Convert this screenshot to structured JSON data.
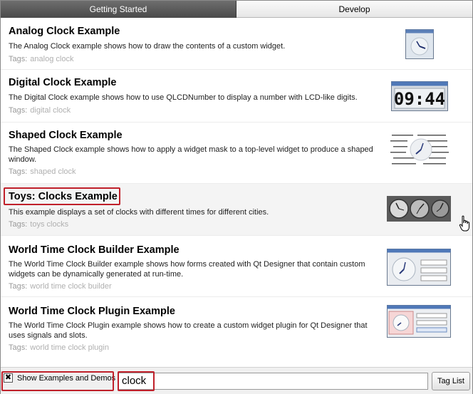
{
  "tabs": [
    {
      "label": "Getting Started",
      "active": true
    },
    {
      "label": "Develop",
      "active": false
    }
  ],
  "tags_label": "Tags:",
  "examples": [
    {
      "title": "Analog Clock Example",
      "description": "The Analog Clock example shows how to draw the contents of a custom widget.",
      "tags": "analog clock",
      "thumbnail": "analog-clock-thumbnail"
    },
    {
      "title": "Digital Clock Example",
      "description": "The Digital Clock example shows how to use QLCDNumber to display a number with LCD-like digits.",
      "tags": "digital clock",
      "thumbnail": "digital-clock-thumbnail",
      "lcd_text": "09:44"
    },
    {
      "title": "Shaped Clock Example",
      "description": "The Shaped Clock example shows how to apply a widget mask to a top-level widget to produce a shaped window.",
      "tags": "shaped clock",
      "thumbnail": "shaped-clock-thumbnail"
    },
    {
      "title": "Toys: Clocks Example",
      "description": "This example displays a set of clocks with different times for different cities.",
      "tags": "toys clocks",
      "thumbnail": "toys-clocks-thumbnail",
      "highlighted": true,
      "hovered": true
    },
    {
      "title": "World Time Clock Builder Example",
      "description": "The World Time Clock Builder example shows how forms created with Qt Designer that contain custom widgets can be dynamically generated at run-time.",
      "tags": "world time clock builder",
      "thumbnail": "world-time-builder-thumbnail"
    },
    {
      "title": "World Time Clock Plugin Example",
      "description": "The World Time Clock Plugin example shows how to create a custom widget plugin for Qt Designer that uses signals and slots.",
      "tags": "world time clock plugin",
      "thumbnail": "world-time-plugin-thumbnail"
    }
  ],
  "footer": {
    "checkbox_label": "Show Examples and Demos",
    "checkbox_checked": true,
    "search_value": "clock",
    "tag_list_label": "Tag List"
  },
  "colors": {
    "highlight_border": "#c0202a",
    "active_tab": "#555555",
    "tag_text": "#9a9a9a"
  }
}
